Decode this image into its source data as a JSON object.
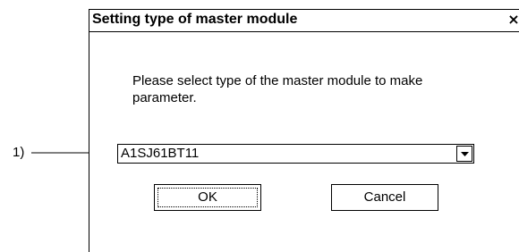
{
  "dialog": {
    "title": "Setting type of master module",
    "close_glyph": "×",
    "prompt": "Please select type of the master module to make parameter.",
    "module_select": {
      "selected_value": "A1SJ61BT11"
    },
    "buttons": {
      "ok_label": "OK",
      "cancel_label": "Cancel"
    }
  },
  "annotation": {
    "label": "1)"
  },
  "icons": {
    "combo_arrow": "chevron-down-icon",
    "close": "close-icon"
  }
}
